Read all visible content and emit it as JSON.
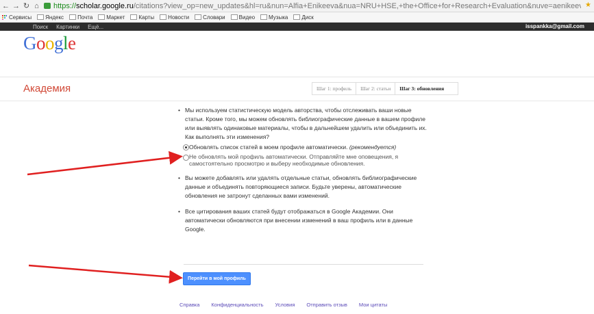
{
  "browser": {
    "url_scheme": "https://",
    "url_host": "scholar.google.ru",
    "url_rest": "/citations?view_op=new_updates&hl=ru&nun=Alfia+Enikeeva&nua=NRU+HSE,+the+Office+for+Research+Evaluation&nuve=aenikeeva",
    "bookmarks": [
      "Сервисы",
      "Яндекс",
      "Почта",
      "Маркет",
      "Карты",
      "Новости",
      "Словари",
      "Видео",
      "Музыка",
      "Диск"
    ]
  },
  "gbar": {
    "items": [
      "Поиск",
      "Картинки",
      "Ещё..."
    ],
    "account": "isspankka@gmail.com"
  },
  "logo": {
    "letters": [
      "G",
      "o",
      "o",
      "g",
      "l",
      "e"
    ]
  },
  "header": {
    "product": "Академия",
    "steps": [
      "Шаг 1: профиль",
      "Шаг 2: статьи",
      "Шаг 3: обновления"
    ]
  },
  "content": {
    "bullet_char": "•",
    "bullet1": "Мы используем статистическую модель авторства, чтобы отслеживать ваши новые статьи. Кроме того, мы можем обновлять библиографические данные в вашем профиле или выявлять одинаковые материалы, чтобы в дальнейшем удалить или объединить их. Как выполнять эти изменения?",
    "option1_label": "Обновлять список статей в моем профиле автоматически.",
    "option1_note": "(рекомендуется)",
    "option2_label": "Не обновлять мой профиль автоматически. Отправляйте мне оповещения, я самостоятельно просмотрю и выберу необходимые обновления.",
    "bullet2": "Вы можете добавлять или удалять отдельные статьи, обновлять библиографические данные и объединять повторяющиеся записи. Будьте уверены, автоматические обновления не затронут сделанных вами изменений.",
    "bullet3": "Все цитирования ваших статей будут отображаться в Google Академии. Они автоматически обновляются при внесении изменений в ваш профиль или в данные Google.",
    "button": "Перейти в мой профиль"
  },
  "footer": {
    "links": [
      "Справка",
      "Конфиденциальность",
      "Условия",
      "Отправить отзыв",
      "Мои цитаты"
    ]
  },
  "colors": {
    "accent_red": "#d14836",
    "button_blue": "#4d90fe",
    "annotation_red": "#e02020",
    "footer_link": "#5b4ab8"
  }
}
